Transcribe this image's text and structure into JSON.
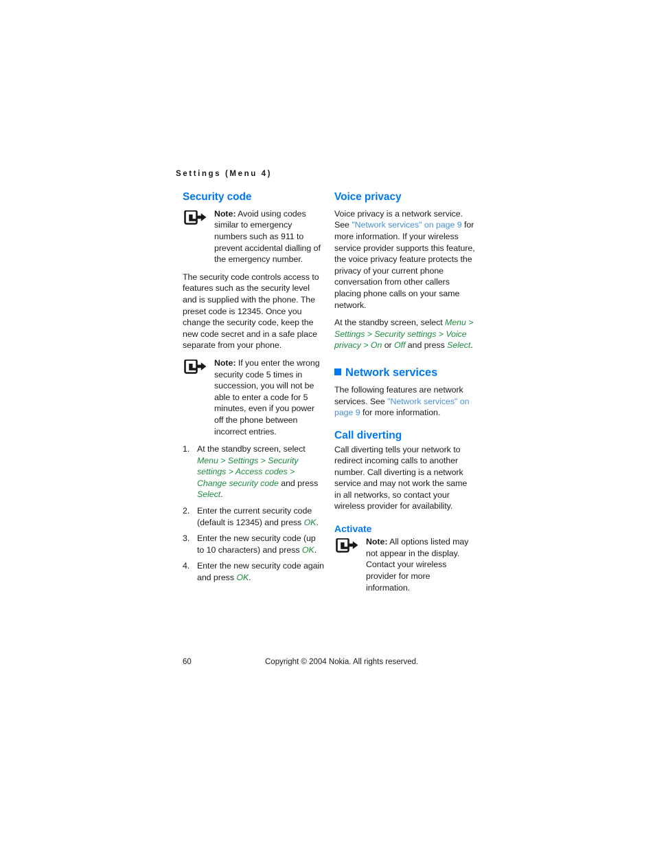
{
  "page": {
    "running_header": "Settings (Menu 4)",
    "folio": "60",
    "copyright": "Copyright © 2004 Nokia. All rights reserved."
  },
  "colors": {
    "heading_blue": "#0078ef",
    "link_blue": "#4a8fd6",
    "menu_path_green": "#1d8a3f",
    "body_text": "#1a1a1a"
  },
  "left_column": {
    "heading": "Security code",
    "note_1": {
      "label": "Note:",
      "text": " Avoid using codes similar to emergency numbers such as 911 to prevent accidental dialling of the emergency number.",
      "icon": "note-pointer-icon"
    },
    "paragraph_1": "The security code controls access to features such as the security level and is supplied with the phone. The preset code is 12345. Once you change the security code, keep the new code secret and in a safe place separate from your phone.",
    "note_2": {
      "label": "Note:",
      "text": " If you enter the wrong security code 5 times in succession, you will not be able to enter a code for 5 minutes, even if you power off the phone between incorrect entries.",
      "icon": "note-pointer-icon"
    },
    "steps": [
      {
        "prefix": "At the standby screen, select ",
        "path": "Menu > Settings > Security settings > Access codes > Change security code",
        "middle": " and press ",
        "action": "Select",
        "suffix": "."
      },
      {
        "prefix": "Enter the current security code (default is 12345) and press ",
        "path": "",
        "middle": "",
        "action": "OK",
        "suffix": "."
      },
      {
        "prefix": "Enter the new security code (up to 10 characters) and press ",
        "path": "",
        "middle": "",
        "action": "OK",
        "suffix": "."
      },
      {
        "prefix": "Enter the new security code again and press ",
        "path": "",
        "middle": "",
        "action": "OK",
        "suffix": "."
      }
    ]
  },
  "right_column": {
    "voice_privacy": {
      "heading": "Voice privacy",
      "para_part1": "Voice privacy is a network service. See ",
      "link": "\"Network services\" on page 9",
      "para_part2": " for more information. If your wireless service provider supports this feature, the voice privacy feature protects the privacy of your current phone conversation from other callers placing phone calls on your same network.",
      "instruction_prefix": "At the standby screen, select ",
      "instruction_path": "Menu > Settings > Security settings > Voice privacy >",
      "instruction_on": "On",
      "instruction_or": " or ",
      "instruction_off": "Off",
      "instruction_mid": " and press ",
      "instruction_action": "Select",
      "instruction_suffix": "."
    },
    "network_services": {
      "heading": "Network services",
      "bullet": "square-bullet-icon",
      "para_part1": "The following features are network services. See ",
      "link": "\"Network services\" on page 9",
      "para_part2": " for more information."
    },
    "call_diverting": {
      "heading": "Call diverting",
      "paragraph": "Call diverting tells your network to redirect incoming calls to another number. Call diverting is a network service and may not work the same in all networks, so contact your wireless provider for availability."
    },
    "activate": {
      "heading": "Activate",
      "note": {
        "label": "Note:",
        "text": " All options listed may not appear in the display. Contact your wireless provider for more information.",
        "icon": "note-pointer-icon"
      }
    }
  }
}
